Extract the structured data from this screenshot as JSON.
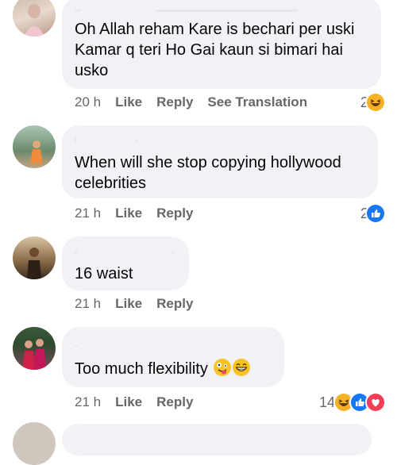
{
  "comments": [
    {
      "text": "Oh Allah reham Kare is bechari per uski Kamar q teri Ho Gai kaun si bimari hai usko",
      "time": "20 h",
      "like": "Like",
      "reply": "Reply",
      "translation": "See Translation",
      "reaction_count": "2",
      "reactions": [
        "laughing-emoji"
      ]
    },
    {
      "text": "When will she stop copying hollywood celebrities",
      "time": "21 h",
      "like": "Like",
      "reply": "Reply",
      "reaction_count": "2",
      "reactions": [
        "like-thumb"
      ]
    },
    {
      "text": "16 waist",
      "time": "21 h",
      "like": "Like",
      "reply": "Reply"
    },
    {
      "text": "Too much flexibility",
      "time": "21 h",
      "like": "Like",
      "reply": "Reply",
      "reaction_count": "14",
      "reactions": [
        "laughing-emoji",
        "like-thumb",
        "love-heart"
      ],
      "inline_emojis": [
        "zany-face-emoji",
        "grinning-face-emoji"
      ]
    }
  ],
  "colors": {
    "bubble": "#f0f2f5",
    "meta": "#65676b",
    "like_blue": "#1877f2",
    "love_red": "#f33e58",
    "haha_yellow": "#f7b125"
  }
}
